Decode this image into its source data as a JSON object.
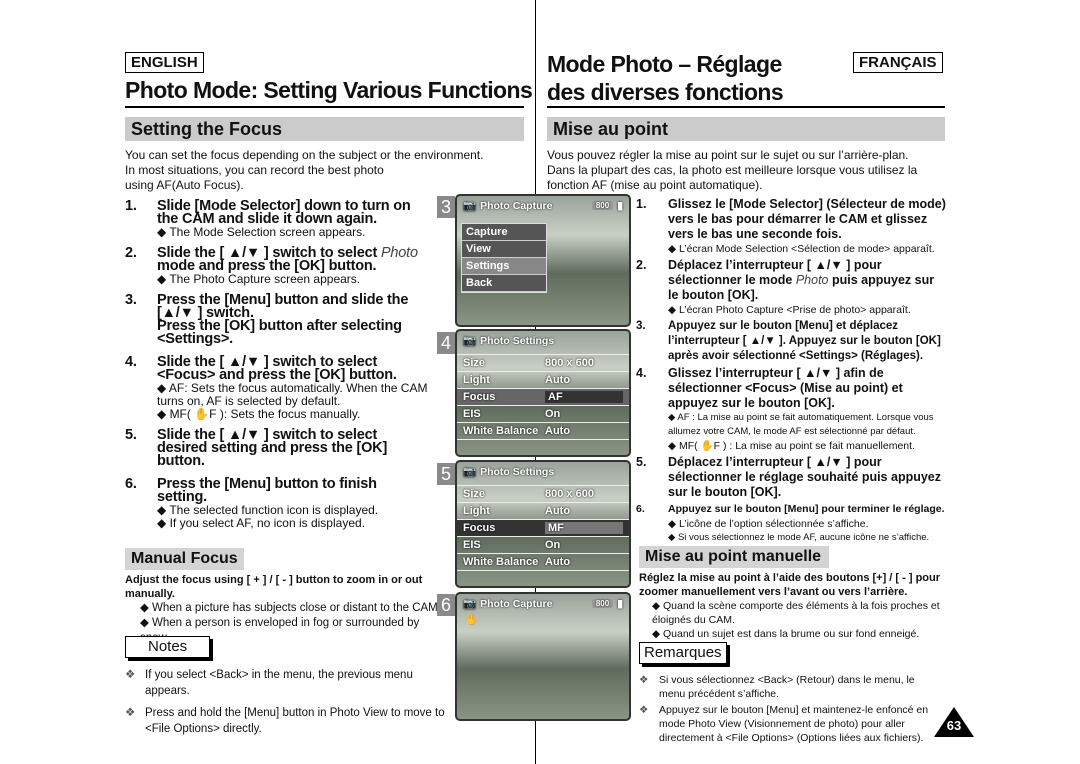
{
  "header": {
    "en_lang": "ENGLISH",
    "fr_lang": "FRANÇAIS",
    "en_title": "Photo Mode: Setting Various Functions",
    "fr_title_1": "Mode Photo – Réglage",
    "fr_title_2": "des diverses fonctions"
  },
  "en": {
    "section": "Setting the Focus",
    "intro": [
      "You can set the focus depending on the subject or the environment.",
      "In most situations, you can record the best photo",
      "using AF(Auto Focus)."
    ],
    "steps": [
      {
        "n": "1.",
        "text": "Slide [Mode Selector] down to turn on the CAM and slide it down again.",
        "bullets": [
          "◆ The Mode Selection screen appears."
        ]
      },
      {
        "n": "2.",
        "text": "Slide the [ ▲/▼ ] switch to select ",
        "italic": "Photo",
        "text2": " mode and press the [OK] button.",
        "bullets": [
          "◆ The Photo Capture screen appears."
        ]
      },
      {
        "n": "3.",
        "text": "Press the [Menu] button and slide the [▲/▼ ] switch.",
        "text2": "Press the [OK] button after selecting <Settings>."
      },
      {
        "n": "4.",
        "text": "Slide the [ ▲/▼ ] switch to select <Focus> and press the [OK] button.",
        "bullets": [
          "◆ AF: Sets the focus automatically. When the CAM turns on, AF is selected by default.",
          "◆ MF( ✋F ): Sets the focus manually."
        ]
      },
      {
        "n": "5.",
        "text": "Slide the [ ▲/▼ ] switch to select desired setting and press the [OK] button."
      },
      {
        "n": "6.",
        "text": "Press the [Menu] button to finish setting.",
        "bullets": [
          "◆ The selected function icon is displayed.",
          "◆ If you select  AF, no icon is displayed."
        ]
      }
    ],
    "manual_title": "Manual Focus",
    "manual_text": "Adjust the focus using [ + ] / [ - ] button to zoom in or out manually.",
    "manual_bullets": [
      "◆ When a picture has subjects close or distant to the CAM",
      "◆ When a person is enveloped in fog or surrounded by snow"
    ],
    "notes_label": "Notes",
    "notes": [
      "If you select <Back> in the menu, the previous menu appears.",
      "Press and hold the [Menu] button in Photo View to move to <File Options> directly."
    ],
    "note_mark": "❖"
  },
  "fr": {
    "section": "Mise au point",
    "intro": [
      "Vous pouvez régler la mise au point sur le sujet ou sur l’arrière-plan.",
      "Dans la plupart des cas, la photo est meilleure lorsque vous utilisez la",
      "fonction AF (mise au point automatique)."
    ],
    "steps": [
      {
        "n": "1.",
        "text": "Glissez le [Mode Selector] (Sélecteur de mode) vers le bas pour démarrer le CAM et glissez vers le bas une seconde fois.",
        "bullets": [
          "◆ L’écran Mode Selection <Sélection de mode> apparaît."
        ]
      },
      {
        "n": "2.",
        "text": "Déplacez l’interrupteur [ ▲/▼ ] pour sélectionner le mode ",
        "italic": "Photo",
        "text2": " puis appuyez sur le bouton [OK].",
        "bullets": [
          "◆ L’écran Photo Capture <Prise de photo> apparaît."
        ]
      },
      {
        "n": "3.",
        "text": "Appuyez sur le bouton [Menu] et déplacez l’interrupteur [ ▲/▼ ]. Appuyez sur le bouton [OK] après avoir sélectionné <Settings> (Réglages)."
      },
      {
        "n": "4.",
        "text": "Glissez l’interrupteur [ ▲/▼ ] afin de sélectionner <Focus> (Mise au point) et appuyez sur le bouton [OK].",
        "bullets": [
          "◆ AF : La mise au point se fait automatiquement. Lorsque vous allumez votre CAM, le mode AF est sélectionné par défaut.",
          "◆ MF( ✋F ) : La mise au point se fait manuellement."
        ]
      },
      {
        "n": "5.",
        "text": "Déplacez l’interrupteur [ ▲/▼ ] pour sélectionner le réglage souhaité puis appuyez sur le bouton [OK]."
      },
      {
        "n": "6.",
        "text": "Appuyez sur le bouton [Menu] pour terminer le réglage.",
        "bullets": [
          "◆ L’icône de l’option sélectionnée s’affiche.",
          "◆ Si vous sélectionnez le mode AF, aucune icône ne s’affiche."
        ]
      }
    ],
    "manual_title": "Mise au point manuelle",
    "manual_text": "Réglez la mise au point à l’aide des boutons [+] / [ - ] pour zoomer manuellement vers l’avant ou vers l’arrière.",
    "manual_bullets": [
      "◆ Quand la scène comporte des éléments à la fois proches et éloignés du CAM.",
      "◆ Quand un sujet est dans la brume ou sur fond enneigé."
    ],
    "notes_label": "Remarques",
    "notes": [
      "Si vous sélectionnez <Back> (Retour) dans le menu, le menu précédent s’affiche.",
      "Appuyez sur le bouton [Menu] et maintenez-le enfoncé en mode Photo View (Visionnement de photo) pour aller directement à <File Options> (Options liées aux fichiers)."
    ]
  },
  "screens": {
    "s3": {
      "num": "3",
      "title": "Photo Capture",
      "res": "800",
      "menu": [
        "Capture",
        "View",
        "Settings",
        "Back"
      ]
    },
    "s4": {
      "num": "4",
      "title": "Photo Settings",
      "rows": [
        [
          "Size",
          "800 x 600"
        ],
        [
          "Light",
          "Auto"
        ],
        [
          "Focus",
          "AF"
        ],
        [
          "EIS",
          "On"
        ],
        [
          "White Balance",
          "Auto"
        ]
      ]
    },
    "s5": {
      "num": "5",
      "title": "Photo Settings",
      "rows": [
        [
          "Size",
          "800 x 600"
        ],
        [
          "Light",
          "Auto"
        ],
        [
          "Focus",
          "MF"
        ],
        [
          "EIS",
          "On"
        ],
        [
          "White Balance",
          "Auto"
        ]
      ]
    },
    "s6": {
      "num": "6",
      "title": "Photo Capture",
      "res": "800"
    }
  },
  "page_number": "63"
}
